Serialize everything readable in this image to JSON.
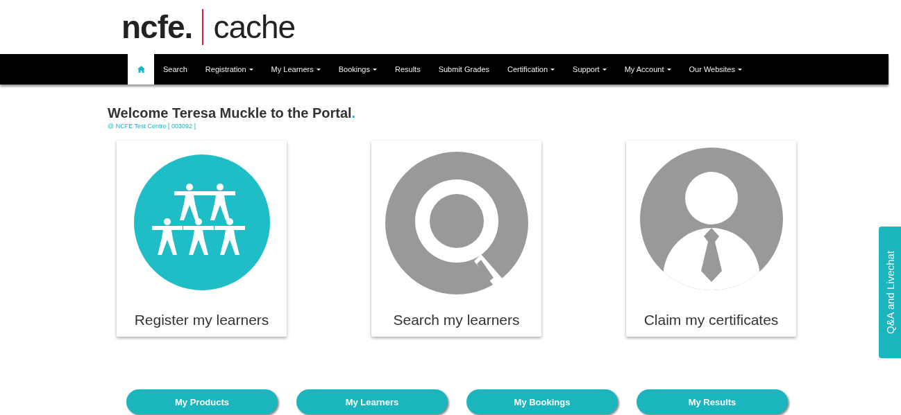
{
  "logo": {
    "left": "ncfe.",
    "right": "cache"
  },
  "nav": [
    {
      "kind": "home",
      "selected": true
    },
    {
      "kind": "link",
      "label": "Search",
      "dropdown": false,
      "selected": false
    },
    {
      "kind": "link",
      "label": "Registration",
      "dropdown": true,
      "selected": false
    },
    {
      "kind": "link",
      "label": "My Learners",
      "dropdown": true,
      "selected": false
    },
    {
      "kind": "link",
      "label": "Bookings",
      "dropdown": true,
      "selected": false
    },
    {
      "kind": "link",
      "label": "Results",
      "dropdown": false,
      "selected": false
    },
    {
      "kind": "link",
      "label": "Submit Grades",
      "dropdown": false,
      "selected": false
    },
    {
      "kind": "link",
      "label": "Certification",
      "dropdown": true,
      "selected": false
    },
    {
      "kind": "link",
      "label": "Support",
      "dropdown": true,
      "selected": false
    },
    {
      "kind": "link",
      "label": "My Account",
      "dropdown": true,
      "selected": false
    },
    {
      "kind": "link",
      "label": "Our Websites",
      "dropdown": true,
      "selected": false
    }
  ],
  "welcome": {
    "title": "Welcome Teresa Muckle to the Portal",
    "dot": ".",
    "centre": "@ NCFE Test Centre [ 003092 ]"
  },
  "cards": [
    {
      "kind": "people",
      "label": "Register my learners"
    },
    {
      "kind": "search",
      "label": "Search my learners"
    },
    {
      "kind": "person",
      "label": "Claim my certificates"
    }
  ],
  "buttons": [
    "My Products",
    "My Learners",
    "My Bookings",
    "My Results"
  ],
  "side_tab": "Q&A and Livechat"
}
